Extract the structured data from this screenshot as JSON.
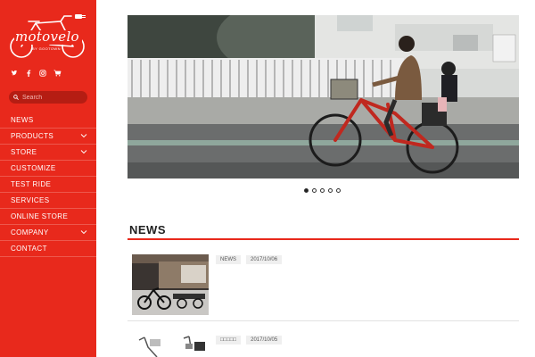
{
  "brand": {
    "name": "motovelo",
    "tagline": "BY GOOTOWN"
  },
  "sidebar": {
    "search_placeholder": "Search",
    "social_icons": [
      "twitter-icon",
      "facebook-icon",
      "instagram-icon",
      "cart-icon"
    ],
    "items": [
      {
        "label": "NEWS",
        "has_submenu": false
      },
      {
        "label": "PRODUCTS",
        "has_submenu": true
      },
      {
        "label": "STORE",
        "has_submenu": true
      },
      {
        "label": "CUSTOMIZE",
        "has_submenu": false
      },
      {
        "label": "TEST RIDE",
        "has_submenu": false
      },
      {
        "label": "SERVICES",
        "has_submenu": false
      },
      {
        "label": "ONLINE STORE",
        "has_submenu": false
      },
      {
        "label": "COMPANY",
        "has_submenu": true
      },
      {
        "label": "CONTACT",
        "has_submenu": false
      }
    ]
  },
  "slider": {
    "slide_count": 5,
    "active_index": 0
  },
  "news": {
    "title": "NEWS",
    "items": [
      {
        "tag": "NEWS",
        "date": "2017/10/06"
      },
      {
        "tag": "□□□□□",
        "date": "2017/10/05"
      }
    ]
  },
  "colors": {
    "accent": "#e8291c",
    "sidebar_dark": "#b51d13"
  }
}
